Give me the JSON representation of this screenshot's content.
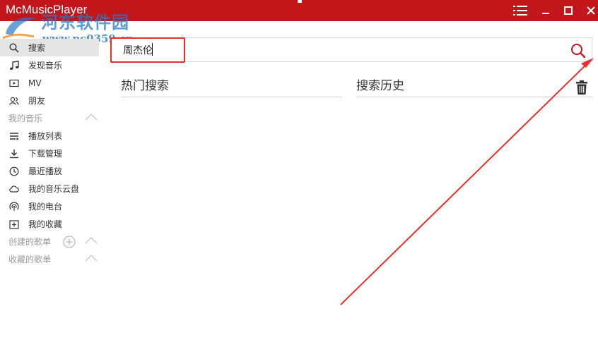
{
  "window": {
    "title": "McMusicPlayer"
  },
  "watermark": {
    "site_name": "河东软件园",
    "url": "www.pc0359.cn"
  },
  "sidebar": {
    "items": [
      {
        "label": "搜索",
        "icon": "search-icon",
        "active": true
      },
      {
        "label": "发现音乐",
        "icon": "music-note-icon"
      },
      {
        "label": "MV",
        "icon": "video-icon"
      },
      {
        "label": "朋友",
        "icon": "friends-icon"
      }
    ],
    "my_music_header": "我的音乐",
    "my_music_items": [
      {
        "label": "播放列表",
        "icon": "playlist-icon"
      },
      {
        "label": "下载管理",
        "icon": "download-icon"
      },
      {
        "label": "最近播放",
        "icon": "clock-icon"
      },
      {
        "label": "我的音乐云盘",
        "icon": "cloud-icon"
      },
      {
        "label": "我的电台",
        "icon": "radio-icon"
      },
      {
        "label": "我的收藏",
        "icon": "favorite-icon"
      }
    ],
    "created_playlists_header": "创建的歌单",
    "collected_playlists_header": "收藏的歌单"
  },
  "search": {
    "value": "周杰伦"
  },
  "hot_search": {
    "title": "热门搜索"
  },
  "search_history": {
    "title": "搜索历史"
  },
  "colors": {
    "accent": "#c3161b",
    "annotation": "#e8302b"
  }
}
